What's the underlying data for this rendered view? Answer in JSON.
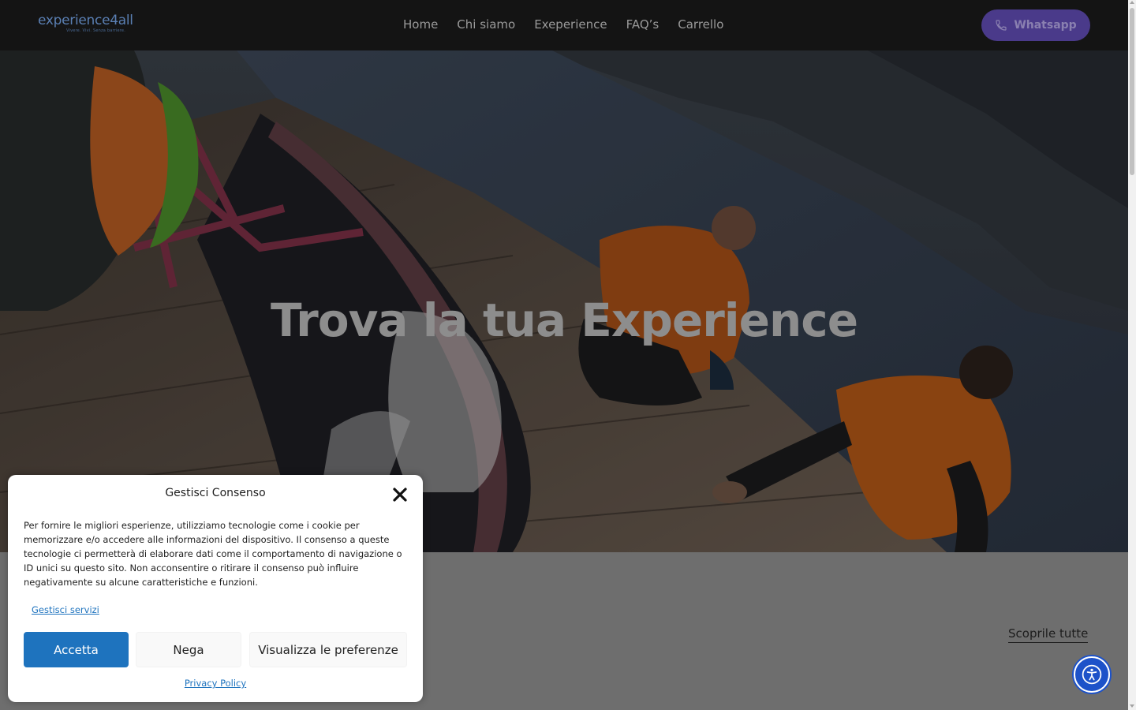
{
  "header": {
    "logo_text": "experience4all",
    "logo_tagline": "Vivere. Vivi. Senza barriere.",
    "nav": [
      {
        "label": "Home"
      },
      {
        "label": "Chi siamo"
      },
      {
        "label": "Exeperience"
      },
      {
        "label": "FAQ’s"
      },
      {
        "label": "Carrello"
      }
    ],
    "whatsapp_label": "Whatsapp",
    "whatsapp_icon": "phone-icon"
  },
  "hero": {
    "title": "Trova la tua Experience"
  },
  "section": {
    "see_all_label": "Scoprile tutte"
  },
  "consent": {
    "title": "Gestisci Consenso",
    "text": "Per fornire le migliori esperienze, utilizziamo tecnologie come i cookie per memorizzare e/o accedere alle informazioni del dispositivo. Il consenso a queste tecnologie ci permetterà di elaborare dati come il comportamento di navigazione o ID unici su questo sito. Non acconsentire o ritirare il consenso può influire negativamente su alcune caratteristiche e funzioni.",
    "manage_services": "Gestisci servizi",
    "accept": "Accetta",
    "deny": "Nega",
    "preferences": "Visualizza le preferenze",
    "privacy_policy": "Privacy Policy"
  },
  "accessibility": {
    "icon": "accessibility-icon"
  },
  "colors": {
    "accent_blue": "#1e73be",
    "whatsapp_button": "#4a3a8a",
    "a11y_button": "#1d52c9"
  }
}
